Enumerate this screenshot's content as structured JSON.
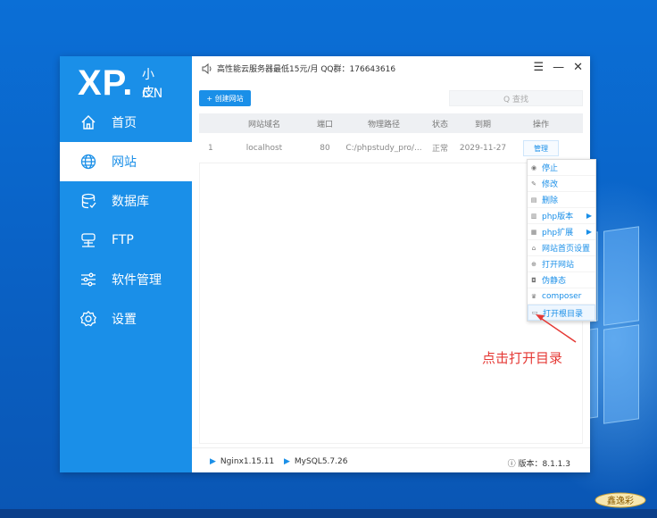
{
  "app": {
    "brand": {
      "xp": "XP",
      "dot": ".",
      "small": "小皮",
      "cn": "CN"
    },
    "notice": "高性能云服务器最低15元/月 QQ群：176643616",
    "window_controls": {
      "menu": "☰",
      "minimize": "—",
      "close": "✕"
    }
  },
  "sidebar": {
    "items": [
      {
        "label": "首页",
        "icon": "home-icon"
      },
      {
        "label": "网站",
        "icon": "globe-icon",
        "active": true
      },
      {
        "label": "数据库",
        "icon": "database-icon"
      },
      {
        "label": "FTP",
        "icon": "server-icon"
      },
      {
        "label": "软件管理",
        "icon": "sliders-icon"
      },
      {
        "label": "设置",
        "icon": "gear-icon"
      }
    ]
  },
  "toolbar": {
    "create_label": "+ 创建网站",
    "search_placeholder": "Q 查找"
  },
  "table": {
    "headers": [
      "",
      "网站域名",
      "端口",
      "物理路径",
      "状态",
      "到期",
      "操作"
    ],
    "rows": [
      {
        "index": "1",
        "domain": "localhost",
        "port": "80",
        "path": "C:/phpstudy_pro/...",
        "status": "正常",
        "expire": "2029-11-27",
        "action": "管理"
      }
    ]
  },
  "context_menu": {
    "items": [
      {
        "label": "停止",
        "icon": "stop-icon"
      },
      {
        "label": "修改",
        "icon": "edit-icon"
      },
      {
        "label": "删除",
        "icon": "delete-icon"
      },
      {
        "label": "php版本",
        "icon": "php-version-icon",
        "submenu": true
      },
      {
        "label": "php扩展",
        "icon": "php-ext-icon",
        "submenu": true
      },
      {
        "label": "网站首页设置",
        "icon": "homepage-icon"
      },
      {
        "label": "打开网站",
        "icon": "open-site-icon"
      },
      {
        "label": "伪静态",
        "icon": "rewrite-icon"
      },
      {
        "label": "composer",
        "icon": "composer-icon"
      },
      {
        "label": "打开根目录",
        "icon": "folder-icon",
        "highlighted": true
      }
    ]
  },
  "footer": {
    "nginx": "Nginx1.15.11",
    "mysql": "MySQL5.7.26",
    "version": "版本：8.1.1.3"
  },
  "annotation": {
    "text": "点击打开目录",
    "color": "#e53935"
  },
  "watermark": "鑫逸彩",
  "colors": {
    "accent": "#1a8fe8",
    "desktop": "#0a63c7"
  }
}
